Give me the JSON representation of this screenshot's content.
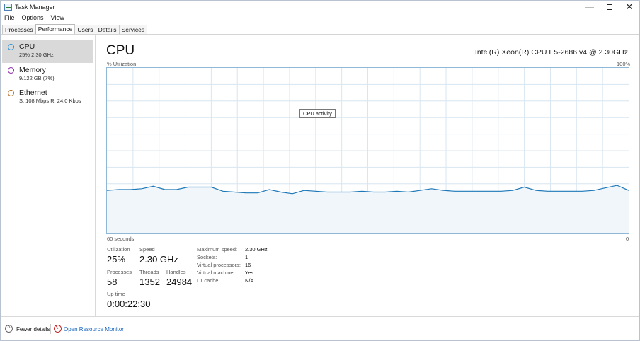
{
  "window": {
    "title": "Task Manager",
    "controls": {
      "minimize": "—",
      "close": "✕"
    }
  },
  "menu": [
    "File",
    "Options",
    "View"
  ],
  "tabs": [
    "Processes",
    "Performance",
    "Users",
    "Details",
    "Services"
  ],
  "active_tab": "Performance",
  "sidebar": {
    "items": [
      {
        "name": "CPU",
        "detail": "25% 2.30 GHz",
        "color": "#1c8ad6",
        "selected": true
      },
      {
        "name": "Memory",
        "detail": "9/122 GB (7%)",
        "color": "#8b1ea8",
        "selected": false
      },
      {
        "name": "Ethernet",
        "detail": "S: 108 Mbps R: 24.0 Kbps",
        "color": "#b4631a",
        "selected": false
      }
    ]
  },
  "main": {
    "title": "CPU",
    "model": "Intel(R) Xeon(R) CPU E5-2686 v4 @ 2.30GHz",
    "graph": {
      "y_label": "% Utilization",
      "y_max_label": "100%",
      "x_left_label": "60 seconds",
      "x_right_label": "0",
      "tooltip": "CPU activity",
      "line_color": "#1c78b8",
      "fill_color": "#f1f6fb",
      "grid_color": "#d8e6f0",
      "utilization_series": [
        26,
        26.5,
        26.5,
        27,
        28.5,
        26.5,
        26.5,
        28,
        28,
        28,
        25.5,
        25,
        24.5,
        24.5,
        26.5,
        25,
        24,
        26,
        25.5,
        25,
        25,
        25,
        25.5,
        25,
        25,
        25.5,
        25,
        26,
        27,
        26,
        25.5,
        25.5,
        25.5,
        25.5,
        25.5,
        26,
        28,
        26,
        25.5,
        25.5,
        25.5,
        25.5,
        26,
        27.5,
        29,
        26
      ]
    },
    "stats": {
      "utilization_label": "Utilization",
      "utilization": "25%",
      "speed_label": "Speed",
      "speed": "2.30 GHz",
      "processes_label": "Processes",
      "processes": "58",
      "threads_label": "Threads",
      "threads": "1352",
      "handles_label": "Handles",
      "handles": "24984",
      "uptime_label": "Up time",
      "uptime": "0:00:22:30"
    },
    "details": [
      {
        "key": "Maximum speed:",
        "value": "2.30 GHz"
      },
      {
        "key": "Sockets:",
        "value": "1"
      },
      {
        "key": "Virtual processors:",
        "value": "16"
      },
      {
        "key": "Virtual machine:",
        "value": "Yes"
      },
      {
        "key": "L1 cache:",
        "value": "N/A"
      }
    ]
  },
  "footer": {
    "fewer_details": "Fewer details",
    "resource_monitor": "Open Resource Monitor"
  }
}
